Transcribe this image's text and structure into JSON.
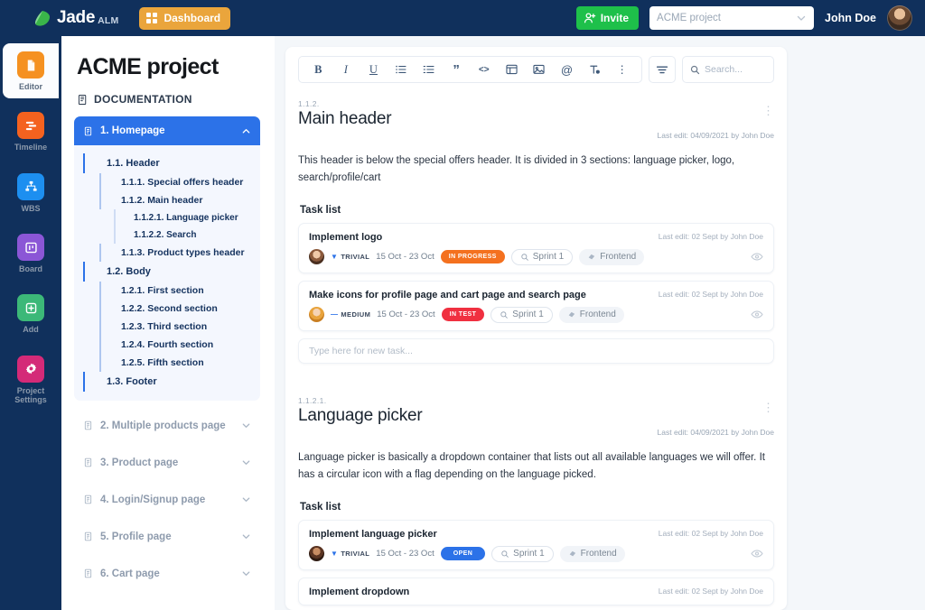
{
  "topbar": {
    "brand_name": "Jade",
    "brand_sub": "ALM",
    "logo_icon": "jade-leaf-logo",
    "dashboard_label": "Dashboard",
    "dashboard_icon": "grid-icon",
    "invite_label": "Invite",
    "invite_icon": "user-plus-icon",
    "project_select_value": "ACME project",
    "project_select_chevron": "chevron-down-icon",
    "user_name": "John Doe",
    "avatar_icon": "user-avatar",
    "accent_navy": "#10305c",
    "accent_orange": "#eaa53c",
    "accent_green": "#1ec04a"
  },
  "rail": {
    "items": [
      {
        "label": "Editor",
        "icon": "document-icon",
        "color": "#f59121",
        "active": true
      },
      {
        "label": "Timeline",
        "icon": "gantt-icon",
        "color": "#f4621f",
        "active": false
      },
      {
        "label": "WBS",
        "icon": "sitemap-icon",
        "color": "#1d8ff0",
        "active": false
      },
      {
        "label": "Board",
        "icon": "board-icon",
        "color": "#8b56d6",
        "active": false
      },
      {
        "label": "Add",
        "icon": "plus-square-icon",
        "color": "#3cb878",
        "active": false
      },
      {
        "label": "Project Settings",
        "icon": "gear-icon",
        "color": "#d42a78",
        "active": false
      }
    ]
  },
  "docnav": {
    "project_title": "ACME project",
    "documentation_label": "DOCUMENTATION",
    "documentation_icon": "book-icon",
    "tree": {
      "root_label": "1. Homepage",
      "root_icon": "page-icon",
      "root_chevron": "chevron-up-icon",
      "nodes": [
        {
          "label": "1.1. Header",
          "level": 2
        },
        {
          "label": "1.1.1. Special offers header",
          "level": 3
        },
        {
          "label": "1.1.2. Main header",
          "level": 3
        },
        {
          "label": "1.1.2.1. Language picker",
          "level": 4
        },
        {
          "label": "1.1.2.2. Search",
          "level": 4
        },
        {
          "label": "1.1.3. Product types header",
          "level": 3
        },
        {
          "label": "1.2. Body",
          "level": 2
        },
        {
          "label": "1.2.1. First section",
          "level": 3
        },
        {
          "label": "1.2.2. Second section",
          "level": 3
        },
        {
          "label": "1.2.3. Third section",
          "level": 3
        },
        {
          "label": "1.2.4. Fourth section",
          "level": 3
        },
        {
          "label": "1.2.5. Fifth section",
          "level": 3
        },
        {
          "label": "1.3. Footer",
          "level": 2
        }
      ]
    },
    "collapsed": [
      {
        "label": "2. Multiple products page",
        "icon": "page-icon",
        "chevron": "chevron-down-icon"
      },
      {
        "label": "3. Product page",
        "icon": "page-icon",
        "chevron": "chevron-down-icon"
      },
      {
        "label": "4. Login/Signup page",
        "icon": "page-icon",
        "chevron": "chevron-down-icon"
      },
      {
        "label": "5. Profile page",
        "icon": "page-icon",
        "chevron": "chevron-down-icon"
      },
      {
        "label": "6. Cart page",
        "icon": "page-icon",
        "chevron": "chevron-down-icon"
      }
    ]
  },
  "toolbar": {
    "buttons": [
      {
        "name": "bold",
        "glyph": "B"
      },
      {
        "name": "italic",
        "glyph": "I"
      },
      {
        "name": "underline",
        "glyph": "U"
      },
      {
        "name": "bullet-list",
        "glyph": "list"
      },
      {
        "name": "numbered-list",
        "glyph": "list"
      },
      {
        "name": "quote",
        "glyph": "”"
      },
      {
        "name": "code",
        "glyph": "<>"
      },
      {
        "name": "table",
        "glyph": "table"
      },
      {
        "name": "image",
        "glyph": "image"
      },
      {
        "name": "mention",
        "glyph": "@"
      },
      {
        "name": "clear-format",
        "glyph": "Tx"
      },
      {
        "name": "more",
        "glyph": "⋮"
      }
    ],
    "filter_icon": "filter-icon",
    "search_placeholder": "Search...",
    "search_icon": "search-icon"
  },
  "sections": [
    {
      "number": "1.1.2.",
      "title": "Main header",
      "last_edit": "Last edit: 04/09/2021 by John Doe",
      "body": "This header is below the special offers header. It is divided in 3 sections: language picker, logo, search/profile/cart",
      "tasklist_label": "Task list",
      "new_task_placeholder": "Type here for new task...",
      "tasks": [
        {
          "title": "Implement logo",
          "last_edit": "Last edit: 02 Sept by John Doe",
          "priority": "TRIVIAL",
          "priority_marker": "▼",
          "dates": "15 Oct - 23 Oct",
          "status": "IN PROGRESS",
          "status_color": "#f4711f",
          "sprint": "Sprint 1",
          "sprint_icon": "sprint-icon",
          "tag": "Frontend",
          "tag_icon": "tag-icon",
          "watch_icon": "eye-icon",
          "avatar": "t-av1"
        },
        {
          "title": "Make icons for profile page and cart page and search page",
          "last_edit": "Last edit: 02 Sept by John Doe",
          "priority": "MEDIUM",
          "priority_marker": "—",
          "dates": "15 Oct - 23 Oct",
          "status": "IN TEST",
          "status_color": "#f03040",
          "sprint": "Sprint 1",
          "sprint_icon": "sprint-icon",
          "tag": "Frontend",
          "tag_icon": "tag-icon",
          "watch_icon": "eye-icon",
          "avatar": "t-av2"
        }
      ]
    },
    {
      "number": "1.1.2.1.",
      "title": "Language picker",
      "last_edit": "Last edit: 04/09/2021 by John Doe",
      "body": "Language picker is basically a dropdown container that lists out all available languages we will offer. It has a circular icon with a flag depending on the language picked.",
      "tasklist_label": "Task list",
      "tasks": [
        {
          "title": "Implement language picker",
          "last_edit": "Last edit: 02 Sept by John Doe",
          "priority": "TRIVIAL",
          "priority_marker": "▼",
          "dates": "15 Oct - 23 Oct",
          "status": "OPEN",
          "status_color": "#2c72e8",
          "sprint": "Sprint 1",
          "sprint_icon": "sprint-icon",
          "tag": "Frontend",
          "tag_icon": "tag-icon",
          "watch_icon": "eye-icon",
          "avatar": "t-av3"
        },
        {
          "title": "Implement dropdown",
          "last_edit": "Last edit: 02 Sept by John Doe",
          "priority": "",
          "priority_marker": "",
          "dates": "",
          "status": "",
          "status_color": "#2c72e8",
          "sprint": "",
          "sprint_icon": "sprint-icon",
          "tag": "",
          "tag_icon": "tag-icon",
          "watch_icon": "eye-icon",
          "avatar": "t-av1"
        }
      ]
    }
  ]
}
